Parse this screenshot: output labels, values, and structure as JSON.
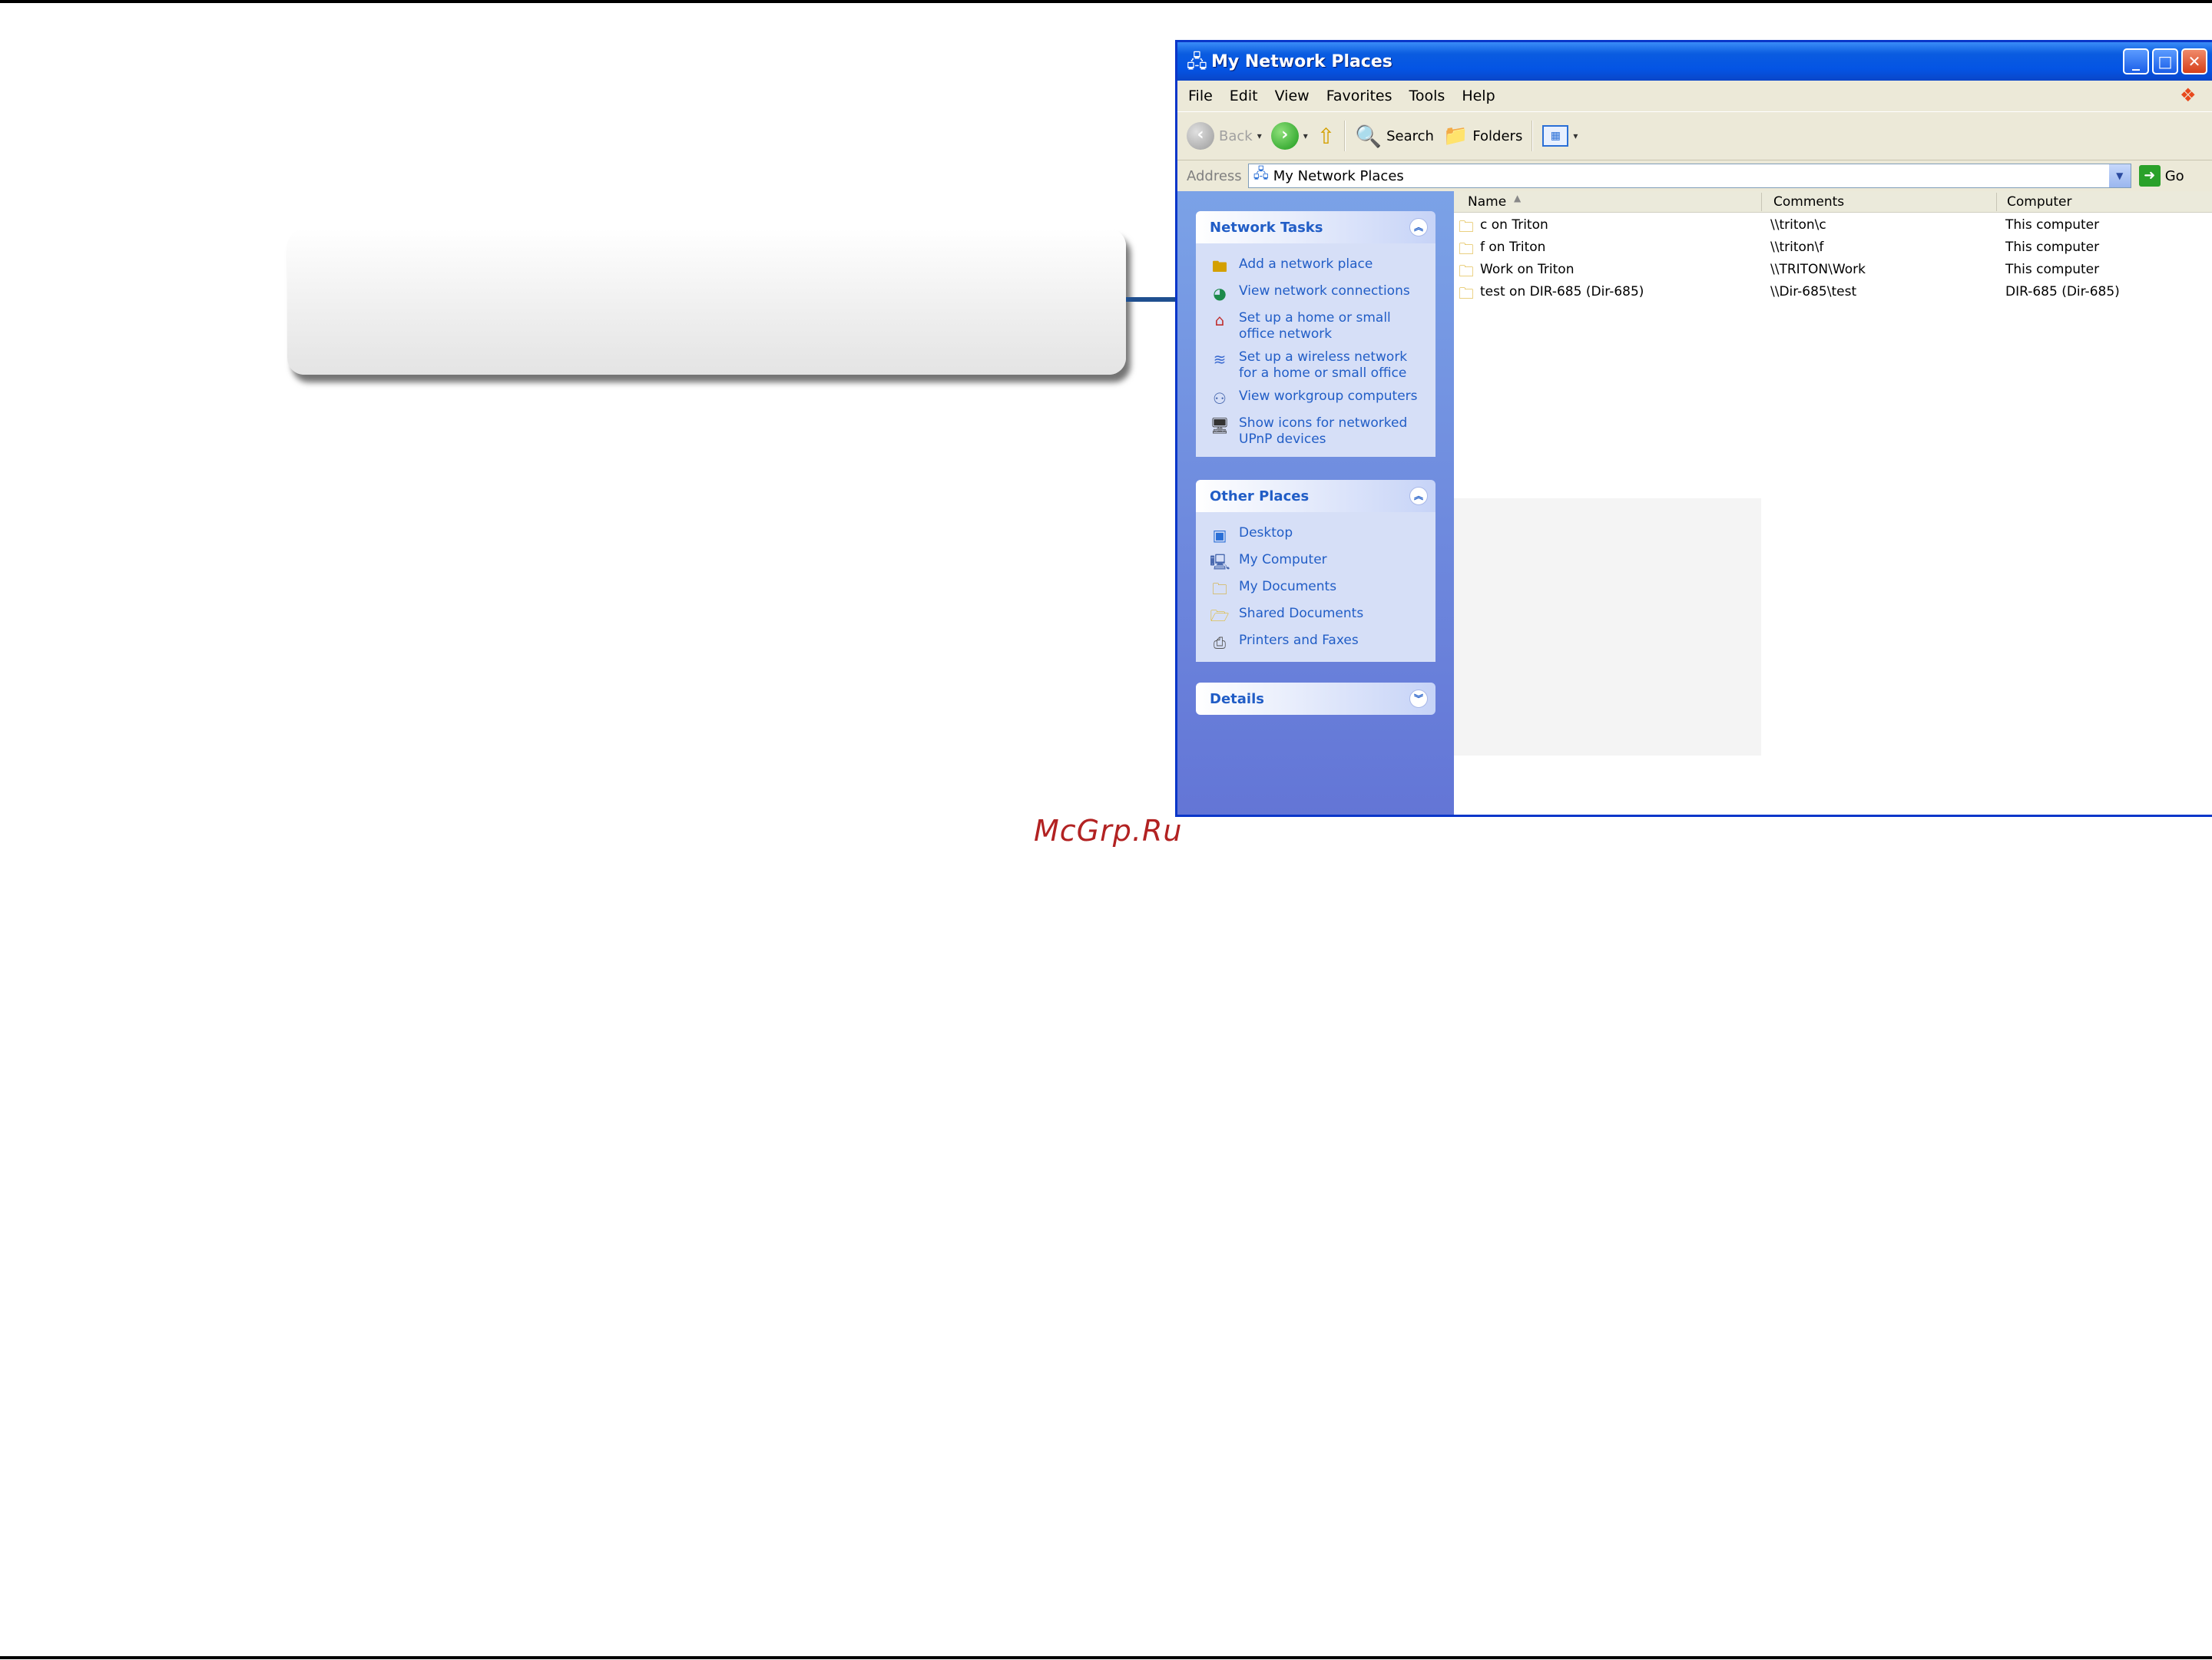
{
  "watermark": "McGrp.Ru",
  "window": {
    "title": "My Network Places",
    "controls": [
      "minimize",
      "maximize",
      "close"
    ]
  },
  "menu": [
    "File",
    "Edit",
    "View",
    "Favorites",
    "Tools",
    "Help"
  ],
  "toolbar": {
    "back": "Back",
    "search": "Search",
    "folders": "Folders"
  },
  "address": {
    "label": "Address",
    "value": "My Network Places",
    "go": "Go"
  },
  "network_tasks": {
    "title": "Network Tasks",
    "items": [
      {
        "label": "Add a network place",
        "icon": "network-place-icon"
      },
      {
        "label": "View network connections",
        "icon": "network-connections-icon"
      },
      {
        "label": "Set up a home or small office network",
        "icon": "home-network-icon"
      },
      {
        "label": "Set up a wireless network for a home or small office",
        "icon": "wireless-icon"
      },
      {
        "label": "View workgroup computers",
        "icon": "workgroup-icon"
      },
      {
        "label": "Show icons for networked UPnP devices",
        "icon": "upnp-icon"
      }
    ]
  },
  "other_places": {
    "title": "Other Places",
    "items": [
      {
        "label": "Desktop",
        "icon": "desktop-icon"
      },
      {
        "label": "My Computer",
        "icon": "computer-icon"
      },
      {
        "label": "My Documents",
        "icon": "documents-icon"
      },
      {
        "label": "Shared Documents",
        "icon": "folder-icon"
      },
      {
        "label": "Printers and Faxes",
        "icon": "printer-icon"
      }
    ]
  },
  "details": {
    "title": "Details"
  },
  "columns": [
    "Name",
    "Comments",
    "Computer"
  ],
  "rows": [
    {
      "name": "c on Triton",
      "comments": "\\\\triton\\c",
      "computer": "This computer"
    },
    {
      "name": "f on Triton",
      "comments": "\\\\triton\\f",
      "computer": "This computer"
    },
    {
      "name": "Work on Triton",
      "comments": "\\\\TRITON\\Work",
      "computer": "This computer"
    },
    {
      "name": "test on DIR-685 (Dir-685)",
      "comments": "\\\\Dir-685\\test",
      "computer": "DIR-685 (Dir-685)"
    }
  ],
  "colors": {
    "accent": "#0a46c8",
    "arrow": "#1f4f8f",
    "watermark": "#b22222"
  }
}
